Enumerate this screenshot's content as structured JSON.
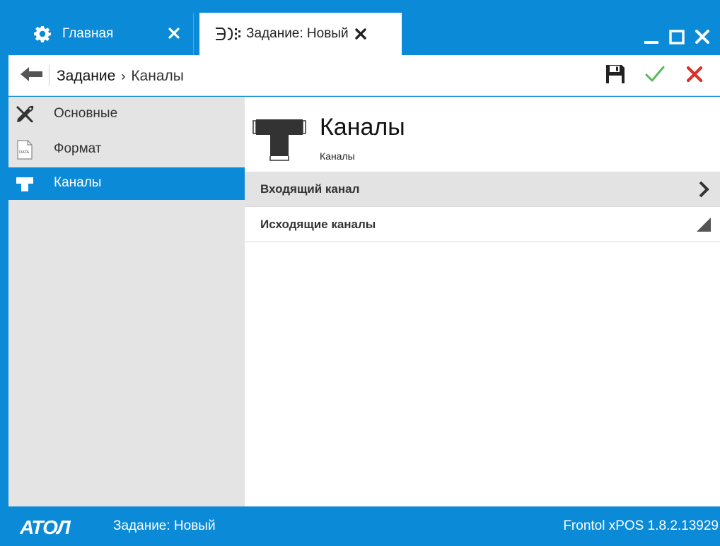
{
  "window": {
    "tabs": [
      {
        "label": "Главная",
        "icon": "gear-icon",
        "active": false
      },
      {
        "label": "Задание: Новый",
        "icon": "channels-merge-icon",
        "active": true
      }
    ],
    "controls": {
      "minimize": "minimize-icon",
      "maximize": "maximize-icon",
      "close": "close-icon"
    }
  },
  "toolbar": {
    "back_icon": "arrow-left-icon",
    "breadcrumb": {
      "parent": "Задание",
      "separator": "›",
      "current": "Каналы"
    },
    "actions": {
      "save": "save-icon",
      "apply": "check-icon",
      "cancel": "close-icon"
    }
  },
  "sidebar": {
    "items": [
      {
        "label": "Основные",
        "icon": "tools-icon",
        "active": false
      },
      {
        "label": "Формат",
        "icon": "data-file-icon",
        "active": false
      },
      {
        "label": "Каналы",
        "icon": "tee-pipe-icon",
        "active": true
      }
    ]
  },
  "main": {
    "title": "Каналы",
    "subtitle": "Каналы",
    "rows": [
      {
        "label": "Входящий канал",
        "icon": "chevron-right-icon"
      },
      {
        "label": "Исходящие каналы",
        "icon": "expand-corner-icon"
      }
    ]
  },
  "statusbar": {
    "logo": "АТОЛ",
    "task": "Задание: Новый",
    "version": "Frontol xPOS 1.8.2.13929"
  },
  "colors": {
    "accent": "#0b8ad8",
    "sidebar_bg": "#e4e4e4",
    "row_highlight": "#e3e3e3",
    "apply": "#5cb85c",
    "cancel": "#d9302c"
  }
}
